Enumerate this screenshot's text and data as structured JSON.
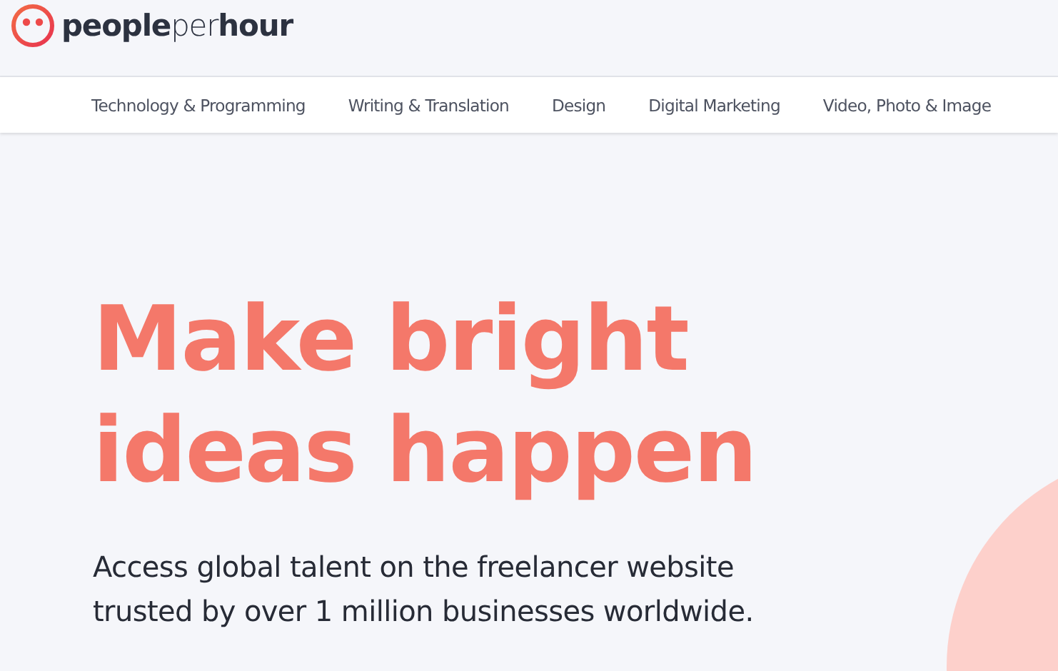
{
  "logo": {
    "text": "**people**per**hour**"
  },
  "nav": {
    "items": [
      {
        "label": "Technology & Programming"
      },
      {
        "label": "Writing & Translation"
      },
      {
        "label": "Design"
      },
      {
        "label": "Digital Marketing"
      },
      {
        "label": "Video, Photo & Image"
      }
    ]
  },
  "hero": {
    "headline": [
      "Make bright",
      "ideas happen"
    ],
    "subtitle": [
      "Access global talent on the freelancer website",
      "trusted by over 1 million businesses worldwide."
    ]
  }
}
